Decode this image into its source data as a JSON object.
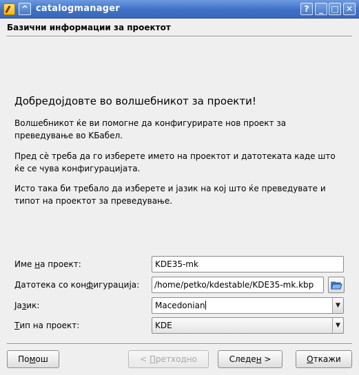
{
  "window": {
    "title": "catalogmanager",
    "controls": {
      "help": "?",
      "minimize": "_",
      "maximize": "□",
      "close": "✕",
      "shade": "^"
    }
  },
  "page": {
    "heading": "Базични информации за проектот",
    "welcome": "Добредојдовте во волшебникот за проекти!",
    "paragraphs": [
      "Волшебникот ќе ви помогне да конфигурирате нов проект за преведување во KБабел.",
      "Пред сè треба да го изберете името на проектот и датотеката каде што ќе се чува конфигурацијата.",
      "Исто така би требало да изберете и јазик на кој што ќе преведувате и типот на проектот за преведување."
    ]
  },
  "form": {
    "name_label": {
      "pre": "Име ",
      "u": "н",
      "post": "а проект:"
    },
    "name_value": "KDE35-mk",
    "config_label": {
      "pre": "Датотека со кон",
      "u": "ф",
      "post": "игурација:"
    },
    "config_value": "/home/petko/kdestable/KDE35-mk.kbp",
    "lang_label": {
      "pre": "Ја",
      "u": "з",
      "post": "ик:"
    },
    "lang_value": "Macedonian",
    "type_label": {
      "pre": "",
      "u": "Т",
      "post": "ип на проект:"
    },
    "type_value": "KDE"
  },
  "buttons": {
    "help": {
      "pre": "По",
      "u": "м",
      "post": "ош"
    },
    "back": {
      "pre": "< ",
      "u": "П",
      "post": "ретходно"
    },
    "next": {
      "pre": "Следе",
      "u": "н",
      "post": " >"
    },
    "cancel": {
      "pre": "",
      "u": "О",
      "post": "ткажи"
    }
  },
  "colors": {
    "titlebar": "#3f70c6",
    "background": "#efefef"
  }
}
